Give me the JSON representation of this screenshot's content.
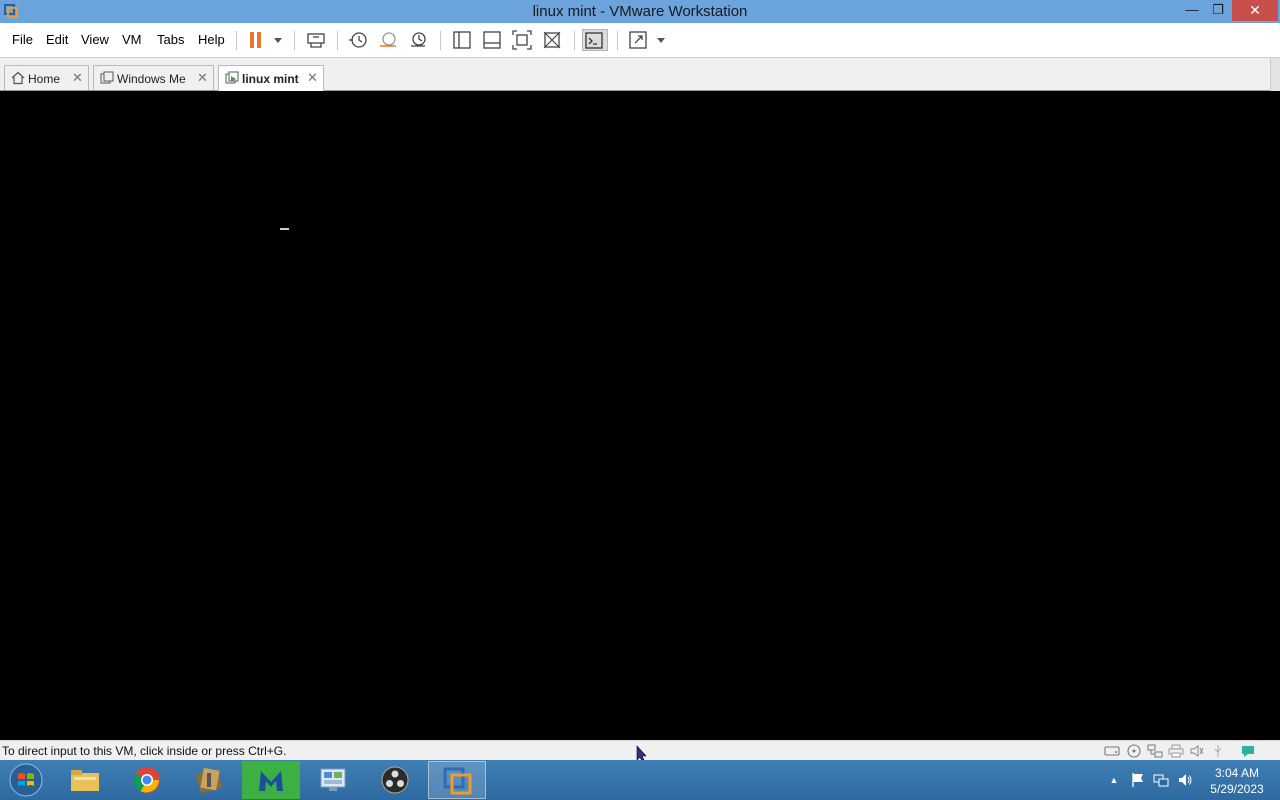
{
  "window": {
    "title": "linux mint - VMware Workstation",
    "minimize_glyph": "—",
    "restore_glyph": "❐",
    "close_glyph": "✕"
  },
  "menu": {
    "items": [
      "File",
      "Edit",
      "View",
      "VM",
      "Tabs",
      "Help"
    ]
  },
  "toolbar": {
    "icons": [
      "pause-icon",
      "dropdown-arrow-icon",
      "send-ctrl-alt-del-icon",
      "snapshot-icon",
      "revert-snapshot-icon",
      "snapshot-manager-icon",
      "show-library-icon",
      "thumbnail-bar-icon",
      "full-screen-icon",
      "unity-icon",
      "console-view-icon",
      "stretch-guest-icon",
      "dropdown-arrow-icon"
    ],
    "accent_color": "#e8772e"
  },
  "tabs": [
    {
      "label": "Home",
      "active": false,
      "icon": "home-icon"
    },
    {
      "label": "Windows Me",
      "active": false,
      "icon": "vm-icon"
    },
    {
      "label": "linux mint",
      "active": true,
      "icon": "vm-running-icon"
    }
  ],
  "tab_close_glyph": "✕",
  "vm": {
    "cursor_text": "_"
  },
  "status": {
    "message": "To direct input to this VM, click inside or press Ctrl+G.",
    "device_icons": [
      "hard-disk-icon",
      "cd-drive-icon",
      "network-adapter-icon",
      "printer-icon",
      "sound-card-icon",
      "usb-icon",
      "message-log-icon"
    ]
  },
  "taskbar": {
    "apps": [
      "file-explorer-icon",
      "chrome-icon",
      "archive-icon",
      "malwarebytes-icon",
      "control-panel-icon",
      "obs-icon",
      "vmware-icon"
    ],
    "tray_icons": [
      "show-hidden-icons-icon",
      "action-center-flag-icon",
      "network-icon",
      "volume-icon"
    ],
    "tray_arrow": "▲",
    "time": "3:04 AM",
    "date": "5/29/2023"
  }
}
